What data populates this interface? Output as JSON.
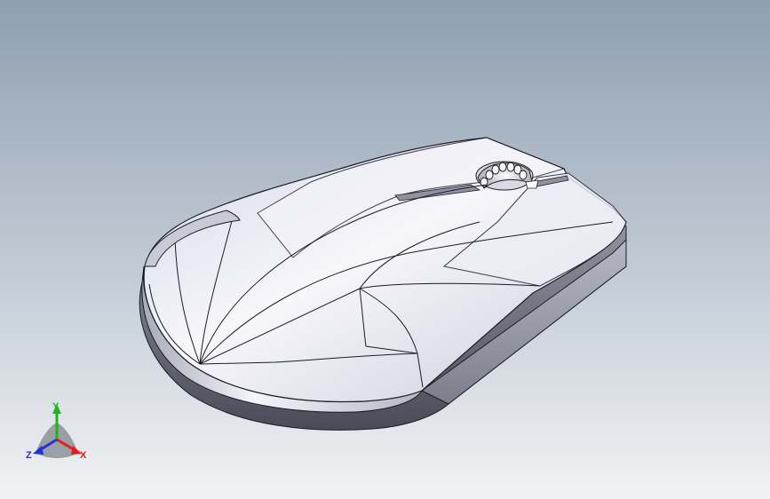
{
  "viewport": {
    "background_top": "#8e9fb1",
    "background_bottom": "#f1f2f3",
    "model": {
      "name": "mouse-model",
      "body_color": "#e8e9f2",
      "highlight_color": "#ffffff",
      "edge_color": "#1c1c24",
      "shadow_color": "#3b3b4a"
    }
  },
  "triad": {
    "x_label": "X",
    "y_label": "Y",
    "z_label": "Z",
    "x_color": "#e0201c",
    "y_color": "#18b818",
    "z_color": "#2430d8"
  }
}
